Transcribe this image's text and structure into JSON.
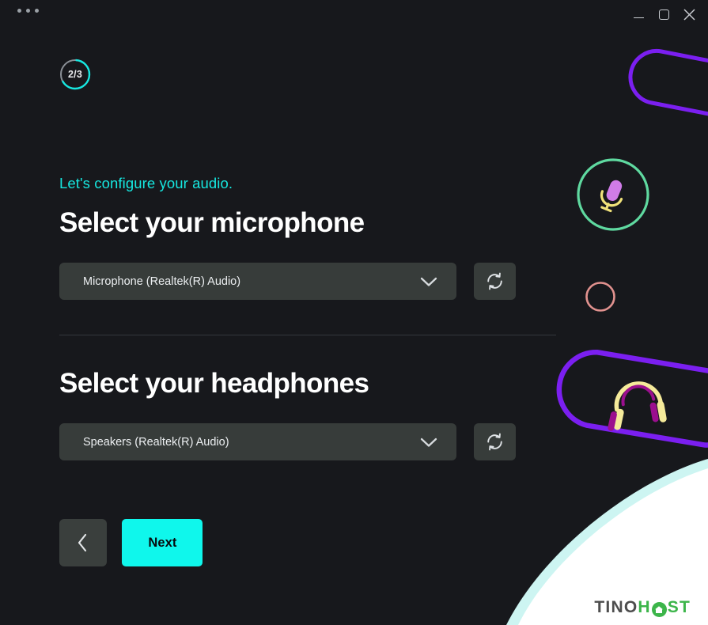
{
  "window": {
    "menu_icon": "three-dots-icon",
    "minimize_label": "Minimize",
    "maximize_label": "Maximize",
    "close_label": "Close"
  },
  "step": {
    "label": "2/3",
    "current": 2,
    "total": 3,
    "ring_color": "#16e7e0",
    "track_color": "#8a8f96"
  },
  "main": {
    "subtitle": "Let's configure your audio.",
    "microphone": {
      "heading": "Select your microphone",
      "selected": "Microphone (Realtek(R) Audio)",
      "chevron_icon": "chevron-down-icon",
      "refresh_icon": "refresh-icon"
    },
    "headphones": {
      "heading": "Select your headphones",
      "selected": "Speakers (Realtek(R) Audio)",
      "chevron_icon": "chevron-down-icon",
      "refresh_icon": "refresh-icon"
    }
  },
  "footer": {
    "back_icon": "chevron-left-icon",
    "next_label": "Next"
  },
  "watermark": {
    "text_dark": "TINO",
    "text_h": "H",
    "text_st": "ST",
    "brand_color": "#3cb54a",
    "dark_color": "#4d4d4d"
  },
  "theme": {
    "background": "#17181c",
    "accent": "#0ff7ec",
    "subtitle_color": "#16e7e0",
    "field_background": "#373c3a",
    "text_primary": "#ffffff",
    "divider": "#33373d"
  },
  "decor": {
    "mic_circle_color": "#5fd9a0",
    "mic_capsule_color": "#d07ce8",
    "mic_stand_color": "#f0e27a",
    "small_circle_color": "#e2928f",
    "pill_color": "#7b1ff0",
    "headphone_band_color": "#f5ea9a",
    "headphone_accent_color": "#9b0f8e",
    "green_arc_color": "#4caf50"
  }
}
